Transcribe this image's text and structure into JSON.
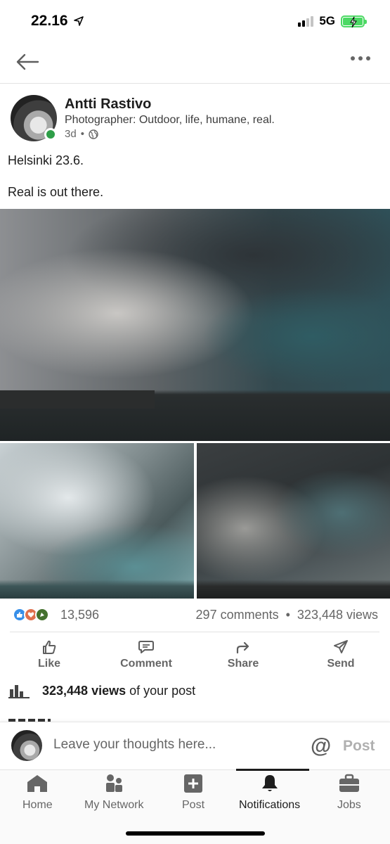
{
  "status_bar": {
    "time": "22.16",
    "network": "5G"
  },
  "post": {
    "author": {
      "name": "Antti Rastivo",
      "headline": "Photographer: Outdoor, life, humane, real.",
      "time_ago": "3d",
      "visibility_icon": "globe-icon",
      "online": true
    },
    "text_line1": "Helsinki 23.6.",
    "text_line2": "Real is out there.",
    "reaction_count": "13,596",
    "comments": "297 comments",
    "separator": "•",
    "views": "323,448 views"
  },
  "actions": [
    {
      "label": "Like",
      "icon": "thumbs-up-icon"
    },
    {
      "label": "Comment",
      "icon": "comment-icon"
    },
    {
      "label": "Share",
      "icon": "share-icon"
    },
    {
      "label": "Send",
      "icon": "send-icon"
    }
  ],
  "analytics": {
    "views_bold": "323,448 views",
    "views_suffix": "of your post"
  },
  "comment_box": {
    "placeholder": "Leave your thoughts here...",
    "mention_symbol": "@",
    "post_label": "Post"
  },
  "tabs": [
    {
      "label": "Home",
      "icon": "home-icon"
    },
    {
      "label": "My Network",
      "icon": "network-icon"
    },
    {
      "label": "Post",
      "icon": "plus-square-icon"
    },
    {
      "label": "Notifications",
      "icon": "bell-icon",
      "active": true
    },
    {
      "label": "Jobs",
      "icon": "briefcase-icon"
    }
  ],
  "colors": {
    "like_blue": "#378fe9",
    "online_green": "#2e9e48",
    "battery_green": "#4cd964"
  }
}
